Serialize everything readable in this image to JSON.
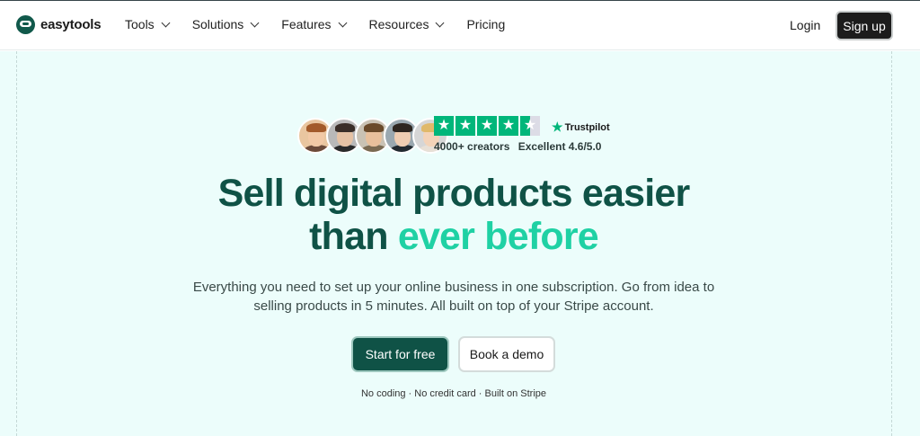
{
  "nav": {
    "logo_text": "easytools",
    "items": [
      {
        "label": "Tools",
        "has_dropdown": true
      },
      {
        "label": "Solutions",
        "has_dropdown": true
      },
      {
        "label": "Features",
        "has_dropdown": true
      },
      {
        "label": "Resources",
        "has_dropdown": true
      },
      {
        "label": "Pricing",
        "has_dropdown": false
      }
    ],
    "login_label": "Login",
    "signup_label": "Sign up"
  },
  "hero": {
    "trustpilot": {
      "brand": "Trustpilot",
      "creators": "4000+ creators",
      "rating_text": "Excellent 4.6/5.0",
      "stars_filled": 4.5,
      "star_color": "#00b67a"
    },
    "headline_line1": "Sell digital products easier",
    "headline_line2_plain": "than ",
    "headline_line2_accent": "ever before",
    "subtitle": "Everything you need to set up your online business in one subscription. Go from idea to selling products in 5 minutes. All built on top of your Stripe account.",
    "primary_cta": "Start for free",
    "secondary_cta": "Book a demo",
    "note": "No coding · No credit card · Built on Stripe"
  },
  "colors": {
    "brand_dark": "#0f5246",
    "accent": "#1fd1a4",
    "hero_bg": "#ecfdfb"
  }
}
